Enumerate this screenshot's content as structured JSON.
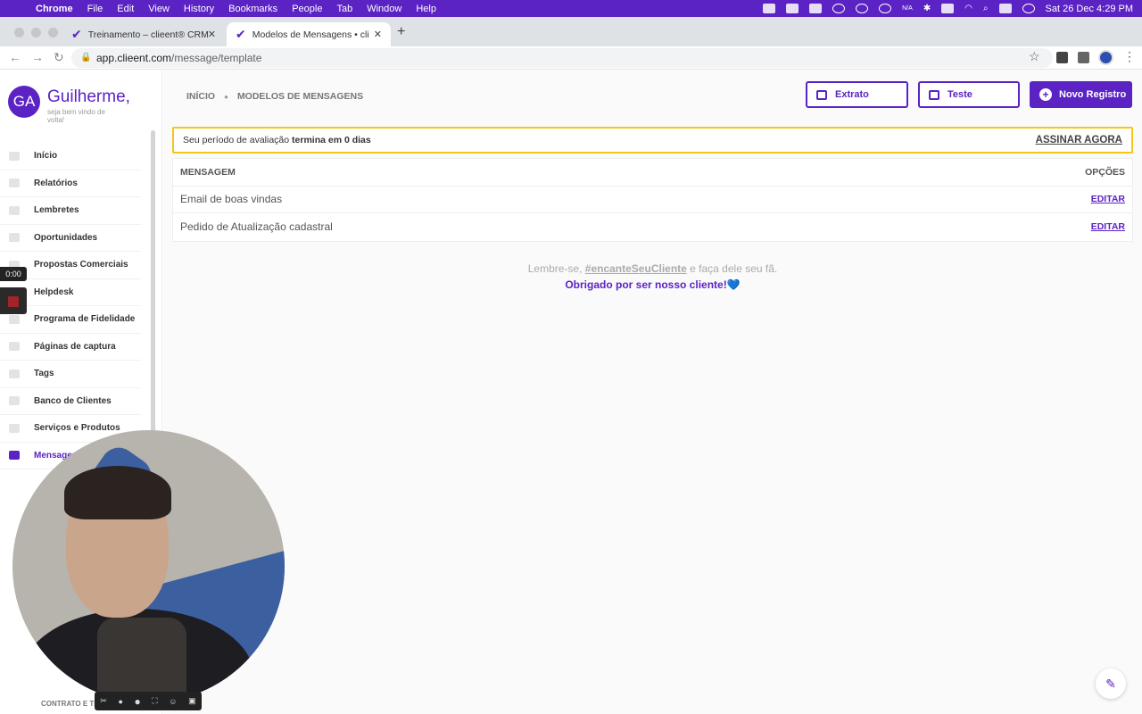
{
  "menubar": {
    "app": "Chrome",
    "items": [
      "File",
      "Edit",
      "View",
      "History",
      "Bookmarks",
      "People",
      "Tab",
      "Window",
      "Help"
    ],
    "status_na": "N/A",
    "datetime": "Sat 26 Dec  4:29 PM"
  },
  "browser": {
    "tabs": [
      {
        "title": "Treinamento – clieent® CRM",
        "active": false
      },
      {
        "title": "Modelos de Mensagens • cliee",
        "active": true
      }
    ],
    "url_host": "app.clieent.com",
    "url_path": "/message/template"
  },
  "sidebar": {
    "avatar_initials": "GA",
    "greeting": "Guilherme,",
    "subtext": "seja bem vindo de volta!",
    "items": [
      {
        "label": "Início"
      },
      {
        "label": "Relatórios"
      },
      {
        "label": "Lembretes"
      },
      {
        "label": "Oportunidades"
      },
      {
        "label": "Propostas Comerciais"
      },
      {
        "label": "Helpdesk"
      },
      {
        "label": "Programa de Fidelidade"
      },
      {
        "label": "Páginas de captura"
      },
      {
        "label": "Tags"
      },
      {
        "label": "Banco de Clientes"
      },
      {
        "label": "Serviços e Produtos"
      },
      {
        "label": "Mensagens",
        "active": true
      }
    ],
    "footer": "CONTRATO E TE"
  },
  "header": {
    "breadcrumb": [
      "INÍCIO",
      "MODELOS DE MENSAGENS"
    ],
    "buttons": {
      "extrato": "Extrato",
      "teste": "Teste",
      "novo": "Novo Registro"
    }
  },
  "trial": {
    "prefix": "Seu período de avaliação ",
    "bold": "termina em 0 dias",
    "cta": "ASSINAR AGORA"
  },
  "table": {
    "col_message": "MENSAGEM",
    "col_options": "OPÇÕES",
    "rows": [
      {
        "name": "Email de boas vindas",
        "action": "EDITAR"
      },
      {
        "name": "Pedido de Atualização cadastral",
        "action": "EDITAR"
      }
    ]
  },
  "note": {
    "before": "Lembre-se, ",
    "tag": "#encanteSeuCliente",
    "after": " e faça dele seu fã.",
    "thanks": "Obrigado por ser nosso cliente!",
    "heart": "💙"
  },
  "recorder": {
    "timer": "0:00"
  },
  "colors": {
    "brand": "#5b22c4",
    "trial_border": "#f5c518"
  }
}
